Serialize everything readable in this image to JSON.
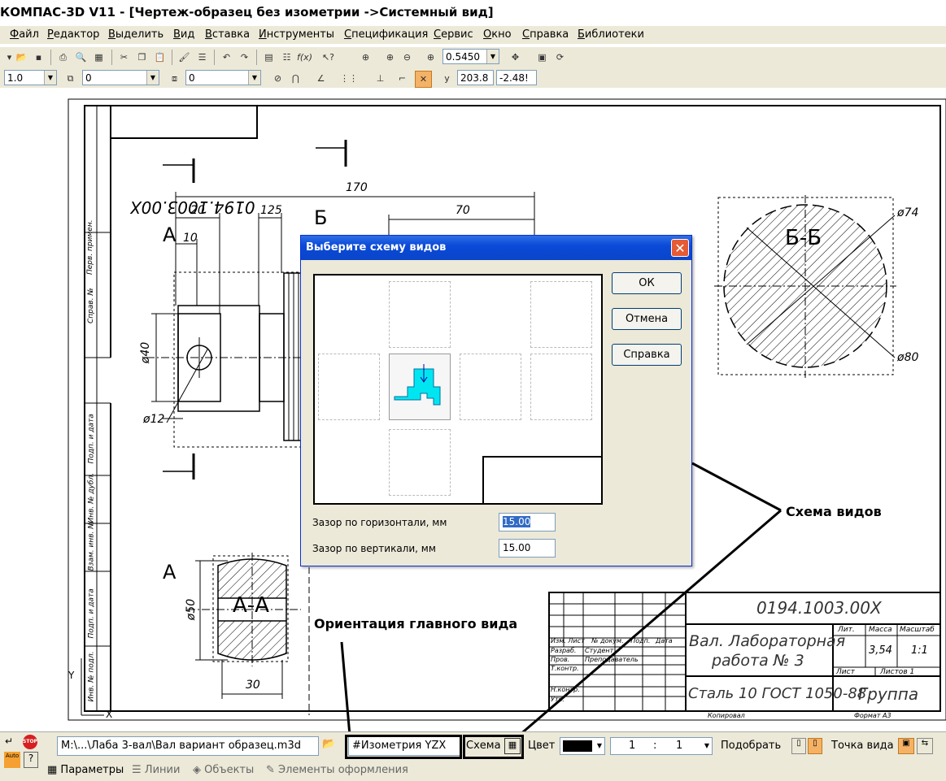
{
  "window": {
    "title": "КОМПАС-3D V11 - [Чертеж-образец без изометрии ->Системный вид]"
  },
  "menu": [
    "Файл",
    "Редактор",
    "Выделить",
    "Вид",
    "Вставка",
    "Инструменты",
    "Спецификация",
    "Сервис",
    "Окно",
    "Справка",
    "Библиотеки"
  ],
  "toolbar": {
    "zoom_value": "0.5450",
    "line_width": "1.0",
    "layer_value": "0",
    "style_value": "0",
    "coord_x": "203.8",
    "coord_y": "-2.48!"
  },
  "drawing": {
    "stamp_code_top": "0194.1003.00Х",
    "stamp_code": "0194.1003.00X",
    "section_bb": "Б-Б",
    "section_aa": "А-А",
    "mark_a": "А",
    "mark_b": "Б",
    "dims": {
      "d170": "170",
      "d20": "20",
      "d125": "125",
      "d70": "70",
      "d10": "10",
      "d40": "ø40",
      "d12": "ø12",
      "d74": "ø74",
      "d80": "ø80",
      "d50": "ø50",
      "d30": "30"
    },
    "title_block": {
      "name_line1": "Вал. Лабораторная",
      "name_line2": "работа № 3",
      "material": "Сталь 10  ГОСТ 1050-88",
      "group": "Группа",
      "mass": "3,54",
      "scale": "1:1",
      "sheet": "Лист",
      "sheets": "Листов  1",
      "lit": "Лит.",
      "mass_lbl": "Масса",
      "scale_lbl": "Масштаб",
      "rows": [
        "Изм.",
        "Лист",
        "№ докум.",
        "Подп.",
        "Дата"
      ],
      "razrab": "Разраб.",
      "prov": "Пров.",
      "tkontr": "Т.контр.",
      "nkontr": "Н.контр.",
      "utv": "Утв.",
      "student": "Студент",
      "prep": "Преподаватель",
      "copied": "Копировал",
      "format": "Формат    А3"
    },
    "side_labels": [
      "Перв. примен.",
      "Справ. №",
      "Подп. и дата",
      "Инв. № дубл.",
      "Взам. инв. №",
      "Подп. и дата",
      "Инв. № подл."
    ],
    "axis_y": "Y",
    "axis_x": "X"
  },
  "dialog": {
    "title": "Выберите схему видов",
    "ok": "ОК",
    "cancel": "Отмена",
    "help": "Справка",
    "gap_h_label": "Зазор по горизонтали, мм",
    "gap_h_value": "15.00",
    "gap_v_label": "Зазор по вертикали, мм",
    "gap_v_value": "15.00"
  },
  "callouts": {
    "scheme": "Схема видов",
    "orientation": "Ориентация главного вида"
  },
  "bottom": {
    "file_path": "M:\\...\\Лаба 3-вал\\Вал вариант образец.m3d",
    "orientation_value": "#Изометрия YZX",
    "scheme_label": "Схема",
    "color_label": "Цвет",
    "scale_num": "1",
    "scale_colon": ":",
    "scale_den": "1",
    "fit_label": "Подобрать",
    "view_point_label": "Точка вида",
    "auto_label": "Auto"
  },
  "tabs": [
    "Параметры",
    "Линии",
    "Объекты",
    "Элементы оформления"
  ],
  "colors": {
    "accent": "#0a4ad8",
    "cad_cyan": "#00e6f0",
    "dialog_bg": "#ece9d8"
  }
}
